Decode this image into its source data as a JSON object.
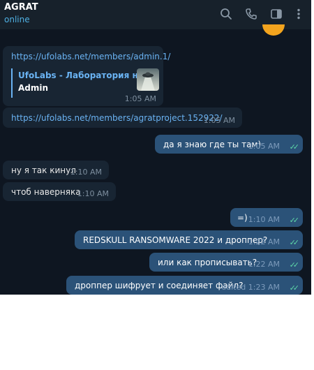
{
  "header": {
    "title": "AGRAT",
    "status": "online"
  },
  "icons": {
    "search": "search-icon",
    "call": "phone-icon",
    "sidebar": "sidebar-toggle-icon",
    "more": "more-vertical-icon"
  },
  "colors": {
    "accent": "#4fb0e3",
    "link": "#6ab3f3",
    "read_ticks": "#5ed8a8",
    "outgoing": "#2b5278",
    "incoming": "#182533"
  },
  "messages": [
    {
      "direction": "in",
      "text": "https://ufolabs.net/members/admin.1/",
      "preview_site": "UfoLabs - Лаборатория нло",
      "preview_title": "Admin",
      "time": "1:05 AM"
    },
    {
      "direction": "in",
      "text": "https://ufolabs.net/members/agratproject.152922/",
      "time": "1:05 AM"
    },
    {
      "direction": "out",
      "text": "да я знаю где ты там)",
      "time": "1:05 AM",
      "read": "✓✓"
    },
    {
      "direction": "in",
      "text": "ну я так кинул",
      "time": "1:10 AM"
    },
    {
      "direction": "in",
      "text": "чтоб наверняка",
      "time": "1:10 AM"
    },
    {
      "direction": "out",
      "text": "=)",
      "time": "1:10 AM",
      "read": "✓✓"
    },
    {
      "direction": "out",
      "text": "REDSKULL RANSOMWARE 2022 и дроппер?",
      "time": "1:22 AM",
      "read": "✓✓"
    },
    {
      "direction": "out",
      "text": "или как прописывать?",
      "time": "1:22 AM",
      "read": "✓✓"
    },
    {
      "direction": "out",
      "text": "дроппер шифрует и соединяет файл?",
      "time": "edited 1:23 AM",
      "read": "✓✓"
    }
  ]
}
